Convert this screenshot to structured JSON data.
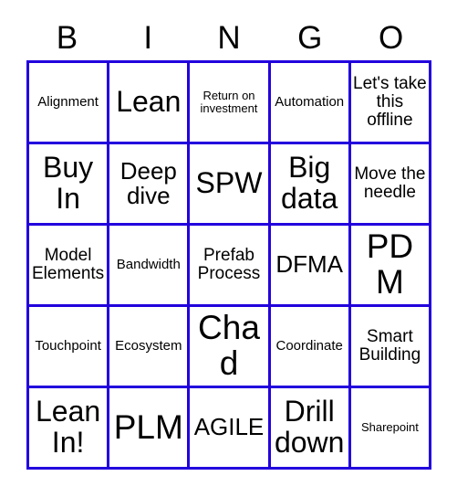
{
  "card": {
    "title": "BINGO",
    "border_color": "#2200dd",
    "text_color": "#000000",
    "background_color": "#ffffff"
  },
  "header": {
    "letters": [
      "B",
      "I",
      "N",
      "G",
      "O"
    ]
  },
  "grid": {
    "rows": 5,
    "columns": 5,
    "cells": [
      {
        "text": "Alignment",
        "size": "sz-s"
      },
      {
        "text": "Lean",
        "size": "sz-xl"
      },
      {
        "text": "Return on investment",
        "size": "sz-xs"
      },
      {
        "text": "Automation",
        "size": "sz-s"
      },
      {
        "text": "Let's take this offline",
        "size": "sz-m"
      },
      {
        "text": "Buy In",
        "size": "sz-xl"
      },
      {
        "text": "Deep dive",
        "size": "sz-l"
      },
      {
        "text": "SPW",
        "size": "sz-xl"
      },
      {
        "text": "Big data",
        "size": "sz-xl"
      },
      {
        "text": "Move the needle",
        "size": "sz-m"
      },
      {
        "text": "Model Elements",
        "size": "sz-m"
      },
      {
        "text": "Bandwidth",
        "size": "sz-s"
      },
      {
        "text": "Prefab Process",
        "size": "sz-m"
      },
      {
        "text": "DFMA",
        "size": "sz-l"
      },
      {
        "text": "PDM",
        "size": "sz-xxl"
      },
      {
        "text": "Touchpoint",
        "size": "sz-s"
      },
      {
        "text": "Ecosystem",
        "size": "sz-s"
      },
      {
        "text": "Chad",
        "size": "sz-xxl"
      },
      {
        "text": "Coordinate",
        "size": "sz-s"
      },
      {
        "text": "Smart Building",
        "size": "sz-m"
      },
      {
        "text": "Lean In!",
        "size": "sz-xl"
      },
      {
        "text": "PLM",
        "size": "sz-xxl"
      },
      {
        "text": "AGILE",
        "size": "sz-l"
      },
      {
        "text": "Drill down",
        "size": "sz-xl"
      },
      {
        "text": "Sharepoint",
        "size": "sz-xs"
      }
    ]
  }
}
